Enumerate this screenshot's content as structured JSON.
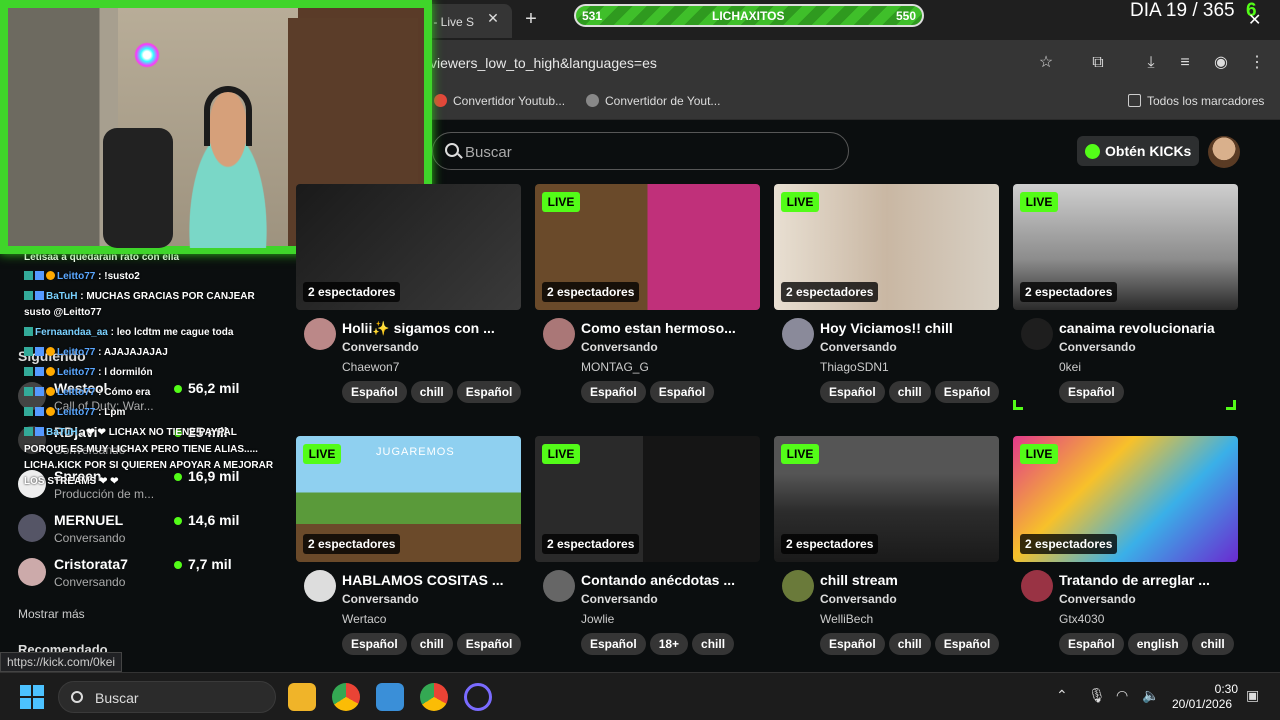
{
  "browser": {
    "tab_title": "} - Live S",
    "url": "viewers_low_to_high&languages=es",
    "bookmarks": [
      "Convertidor Youtub...",
      "Convertidor de Yout...",
      "Todos los marcadores"
    ],
    "status_url": "https://kick.com/0kei"
  },
  "overlay": {
    "progress_left": "531",
    "progress_label": "LICHAXITOS",
    "progress_right": "550",
    "progress_fraction": 0.965,
    "day_counter": "DIA 19 / 365",
    "day_k": "6"
  },
  "kick": {
    "search_placeholder": "Buscar",
    "kicks_button": "Obtén KICKs"
  },
  "sidebar": {
    "followed_heading": "Siguiendo",
    "items": [
      {
        "name": "Westcol",
        "category": "Call of Duty: War...",
        "viewers": "56,2 mil"
      },
      {
        "name": "RDjavi",
        "category": "Conversando",
        "viewers": "25 mil"
      },
      {
        "name": "Spreen",
        "category": "Producción de m...",
        "viewers": "16,9 mil"
      },
      {
        "name": "MERNUEL",
        "category": "Conversando",
        "viewers": "14,6 mil"
      },
      {
        "name": "Cristorata7",
        "category": "Conversando",
        "viewers": "7,7 mil"
      }
    ],
    "more": "Mostrar más",
    "recommended": "Recomendado"
  },
  "chat": [
    {
      "user": "",
      "text": "Letisaa a quedarain rato con ella"
    },
    {
      "user": "Leitto77",
      "text": ": !susto2"
    },
    {
      "user": "BaTuH",
      "text": ": MUCHAS GRACIAS POR CANJEAR"
    },
    {
      "user": "",
      "text": "susto @Leitto77"
    },
    {
      "user": "Fernaandaa_aa",
      "text": ": leo lcdtm me cague toda"
    },
    {
      "user": "Leitto77",
      "text": ": AJAJAJAJAJ"
    },
    {
      "user": "Leitto77",
      "text": ": l dormilón"
    },
    {
      "user": "Leitto77",
      "text": ": Cómo era"
    },
    {
      "user": "Leitto77",
      "text": ": Lpm"
    },
    {
      "user": "BaTuH",
      "text": ": ❤ ❤ LICHAX NO TIENE PAYPAL"
    },
    {
      "user": "",
      "text": "PORQUE ES MUY LICHAX PERO TIENE ALIAS....."
    },
    {
      "user": "",
      "text": "LICHA.KICK POR SI QUIEREN APOYAR A MEJORAR"
    },
    {
      "user": "",
      "text": "LOS STREAMS ❤ ❤"
    }
  ],
  "streams": [
    {
      "title": "Holii✨ sigamos con ...",
      "category": "Conversando",
      "user": "Chaewon7",
      "viewers": "2 espectadores",
      "live": "",
      "tags": [
        "Español",
        "chill",
        "Español"
      ]
    },
    {
      "title": "Como estan hermoso...",
      "category": "Conversando",
      "user": "MONTAG_G",
      "viewers": "2 espectadores",
      "live": "LIVE",
      "tags": [
        "Español",
        "Español"
      ]
    },
    {
      "title": "Hoy Viciamos!! chill",
      "category": "Conversando",
      "user": "ThiagoSDN1",
      "viewers": "2 espectadores",
      "live": "LIVE",
      "tags": [
        "Español",
        "chill",
        "Español"
      ]
    },
    {
      "title": "canaima revolucionaria",
      "category": "Conversando",
      "user": "0kei",
      "viewers": "2 espectadores",
      "live": "LIVE",
      "tags": [
        "Español"
      ]
    },
    {
      "title": "HABLAMOS COSITAS ...",
      "category": "Conversando",
      "user": "Wertaco",
      "viewers": "2 espectadores",
      "live": "LIVE",
      "tags": [
        "Español",
        "chill",
        "Español"
      ]
    },
    {
      "title": "Contando anécdotas ...",
      "category": "Conversando",
      "user": "Jowlie",
      "viewers": "2 espectadores",
      "live": "LIVE",
      "tags": [
        "Español",
        "18+",
        "chill"
      ]
    },
    {
      "title": "chill stream",
      "category": "Conversando",
      "user": "WelliBech",
      "viewers": "2 espectadores",
      "live": "LIVE",
      "tags": [
        "Español",
        "chill",
        "Español"
      ]
    },
    {
      "title": "Tratando de arreglar ...",
      "category": "Conversando",
      "user": "Gtx4030",
      "viewers": "2 espectadores",
      "live": "LIVE",
      "tags": [
        "Español",
        "english",
        "chill"
      ]
    }
  ],
  "thumb_text": {
    "jugaremos": "JUGAREMOS"
  },
  "taskbar": {
    "search_placeholder": "Buscar",
    "time": "0:30",
    "date": "20/01/2026"
  },
  "colors": {
    "kick_green": "#53fc18",
    "background": "#0b0e0f",
    "tag_bg": "#353535"
  }
}
